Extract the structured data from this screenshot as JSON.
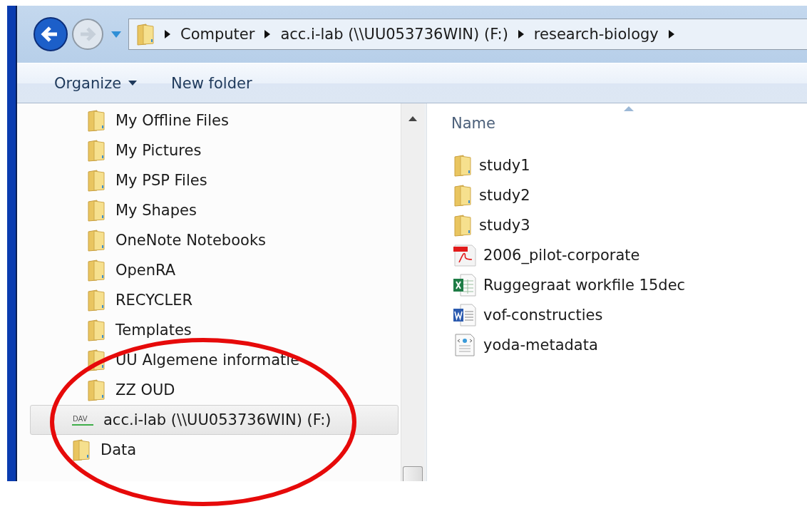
{
  "navigation": {
    "back_enabled": true,
    "forward_enabled": false
  },
  "address_bar": {
    "breadcrumbs": [
      "Computer",
      "acc.i-lab (\\\\UU053736WIN) (F:)",
      "research-biology"
    ]
  },
  "toolbar": {
    "buttons": [
      {
        "label": "Organize",
        "kind": "dropdown"
      },
      {
        "label": "New folder",
        "kind": "plain"
      }
    ]
  },
  "sidebar": {
    "folders": [
      {
        "label": "My Offline Files"
      },
      {
        "label": "My Pictures"
      },
      {
        "label": "My PSP Files"
      },
      {
        "label": "My Shapes"
      },
      {
        "label": "OneNote Notebooks"
      },
      {
        "label": "OpenRA"
      },
      {
        "label": "RECYCLER"
      },
      {
        "label": "Templates"
      },
      {
        "label": "UU Algemene informatie"
      },
      {
        "label": "ZZ OUD"
      }
    ],
    "items": [
      {
        "label": "acc.i-lab (\\\\UU053736WIN) (F:)",
        "kind": "drive",
        "icon_text": "DAV",
        "selected": true
      },
      {
        "label": "Data",
        "kind": "folder",
        "selected": false
      }
    ]
  },
  "file_list": {
    "columns": [
      "Name"
    ],
    "rows": [
      {
        "name": "study1",
        "kind": "folder"
      },
      {
        "name": "study2",
        "kind": "folder"
      },
      {
        "name": "study3",
        "kind": "folder"
      },
      {
        "name": "2006_pilot-corporate",
        "kind": "pdf"
      },
      {
        "name": "Ruggegraat workfile 15dec",
        "kind": "excel"
      },
      {
        "name": "vof-constructies",
        "kind": "word"
      },
      {
        "name": "yoda-metadata",
        "kind": "xml"
      }
    ]
  }
}
